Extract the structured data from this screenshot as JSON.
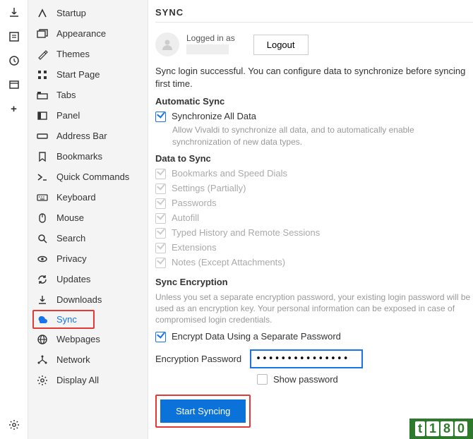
{
  "rail": {
    "icons": [
      "download",
      "panel",
      "history",
      "window",
      "add"
    ]
  },
  "sidebar": {
    "items": [
      {
        "icon": "startup",
        "label": "Startup"
      },
      {
        "icon": "appearance",
        "label": "Appearance"
      },
      {
        "icon": "themes",
        "label": "Themes"
      },
      {
        "icon": "startpage",
        "label": "Start Page"
      },
      {
        "icon": "tabs",
        "label": "Tabs"
      },
      {
        "icon": "panel",
        "label": "Panel"
      },
      {
        "icon": "addressbar",
        "label": "Address Bar"
      },
      {
        "icon": "bookmarks",
        "label": "Bookmarks"
      },
      {
        "icon": "quickcommands",
        "label": "Quick Commands"
      },
      {
        "icon": "keyboard",
        "label": "Keyboard"
      },
      {
        "icon": "mouse",
        "label": "Mouse"
      },
      {
        "icon": "search",
        "label": "Search"
      },
      {
        "icon": "privacy",
        "label": "Privacy"
      },
      {
        "icon": "updates",
        "label": "Updates"
      },
      {
        "icon": "downloads",
        "label": "Downloads"
      },
      {
        "icon": "sync",
        "label": "Sync"
      },
      {
        "icon": "webpages",
        "label": "Webpages"
      },
      {
        "icon": "network",
        "label": "Network"
      },
      {
        "icon": "displayall",
        "label": "Display All"
      }
    ]
  },
  "content": {
    "title": "SYNC",
    "logged_in_as": "Logged in as",
    "logout": "Logout",
    "login_success": "Sync login successful. You can configure data to synchronize before syncing first time.",
    "auto_sync_title": "Automatic Sync",
    "sync_all_label": "Synchronize All Data",
    "sync_all_hint": "Allow Vivaldi to synchronize all data, and to automatically enable synchronization of new data types.",
    "data_to_sync_title": "Data to Sync",
    "data_items": [
      "Bookmarks and Speed Dials",
      "Settings (Partially)",
      "Passwords",
      "Autofill",
      "Typed History and Remote Sessions",
      "Extensions",
      "Notes (Except Attachments)"
    ],
    "enc_title": "Sync Encryption",
    "enc_hint": "Unless you set a separate encryption password, your existing login password will be used as an encryption key. Your personal information can be exposed in case of compromised login credentials.",
    "enc_check_label": "Encrypt Data Using a Separate Password",
    "enc_field_label": "Encryption Password",
    "enc_value": "•••••••••••••••",
    "show_pw": "Show password",
    "start_btn": "Start Syncing"
  },
  "watermark": {
    "t": "t",
    "one": "1",
    "eight": "8",
    "zero": "0"
  }
}
